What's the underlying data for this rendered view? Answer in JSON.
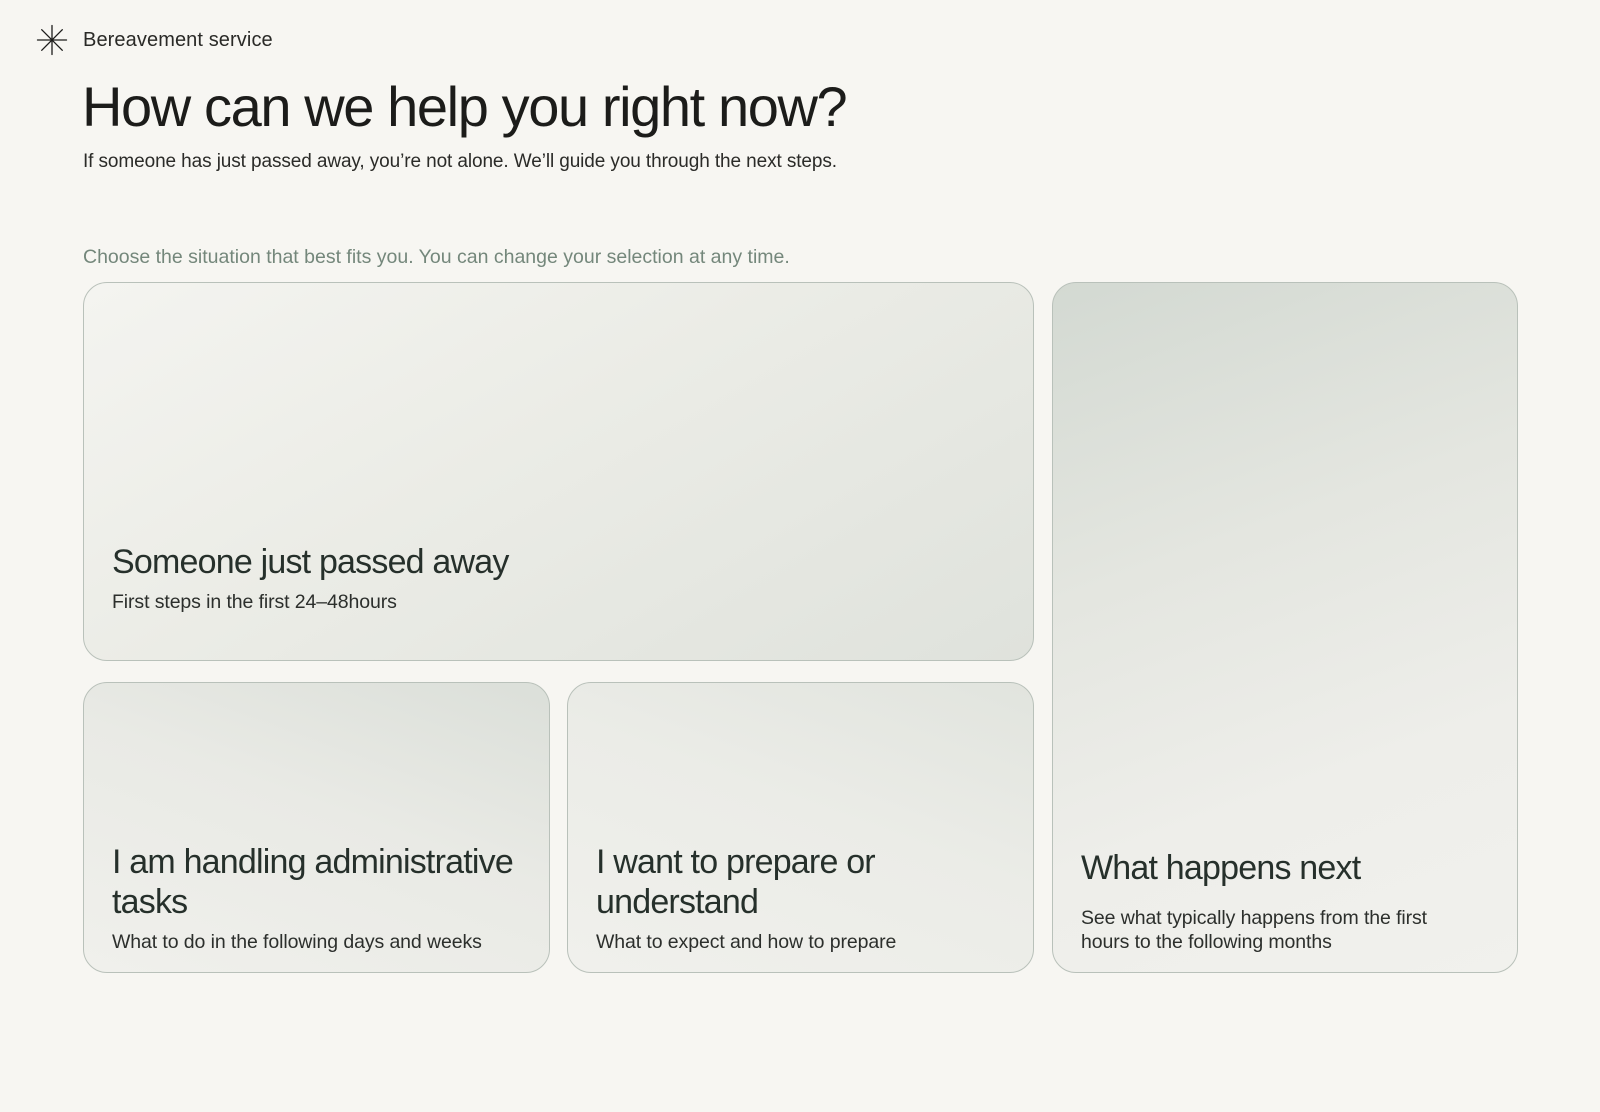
{
  "brand": {
    "icon": "asterisk-icon",
    "name": "Bereavement service"
  },
  "hero": {
    "title": "How can we help you right now?",
    "subtitle": "If someone has just passed away, you’re not alone. We’ll guide you through the next steps."
  },
  "selection": {
    "instruction": "Choose the situation that best fits you. You can change your selection at any time.",
    "cards": [
      {
        "title": "Someone just passed away",
        "description": "First steps in the first 24–48hours"
      },
      {
        "title": "I am handling administrative tasks",
        "description": "What to do in the following days and weeks"
      },
      {
        "title": "I want to prepare or understand",
        "description": "What to expect and how to prepare"
      },
      {
        "title": "What happens next",
        "description": "See what typically happens from the first hours to the following months"
      }
    ]
  },
  "colors": {
    "background": "#f7f6f2",
    "text": "#1d1d1b",
    "instruction": "#74877b",
    "card_border": "#b9c1ba"
  }
}
